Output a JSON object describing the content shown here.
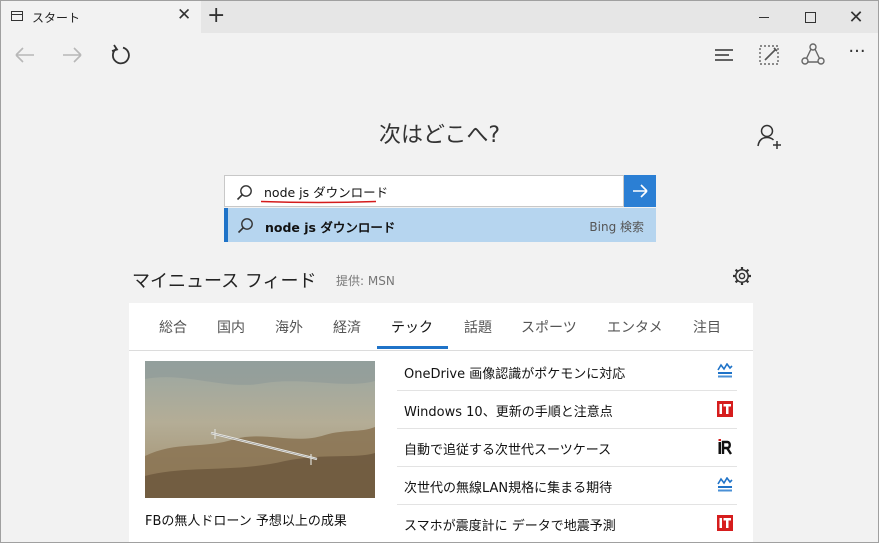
{
  "browser": {
    "tab_title": "スタート",
    "tab_close": "✕",
    "new_tab": "+",
    "window_close": "✕",
    "more_menu": "···"
  },
  "page": {
    "heading": "次はどこへ?"
  },
  "search": {
    "value": "node js ダウンロード",
    "suggestion_text": "node js ダウンロード",
    "suggestion_source": "Bing 検索"
  },
  "feed": {
    "title": "マイニュース フィード",
    "provider": "提供: MSN",
    "tabs": [
      {
        "label": "総合"
      },
      {
        "label": "国内"
      },
      {
        "label": "海外"
      },
      {
        "label": "経済"
      },
      {
        "label": "テック",
        "active": true
      },
      {
        "label": "話題"
      },
      {
        "label": "スポーツ"
      },
      {
        "label": "エンタメ"
      },
      {
        "label": "注目"
      }
    ],
    "featured_caption": "FBの無人ドローン 予想以上の成果",
    "news": [
      {
        "title": "OneDrive 画像認識がポケモンに対応",
        "source_icon": "drive-logo-icon"
      },
      {
        "title": "Windows 10、更新の手順と注意点",
        "source_icon": "it-logo-icon"
      },
      {
        "title": "自動で追従する次世代スーツケース",
        "source_icon": "ir-logo-icon"
      },
      {
        "title": "次世代の無線LAN規格に集まる期待",
        "source_icon": "drive-logo-icon"
      },
      {
        "title": "スマホが震度計に データで地震予測",
        "source_icon": "it-logo-icon"
      }
    ]
  },
  "colors": {
    "accent": "#1f73c8",
    "go_button": "#2b7fd4",
    "suggestion_bg": "#b6d5ef",
    "it_logo": "#d61d1d"
  }
}
